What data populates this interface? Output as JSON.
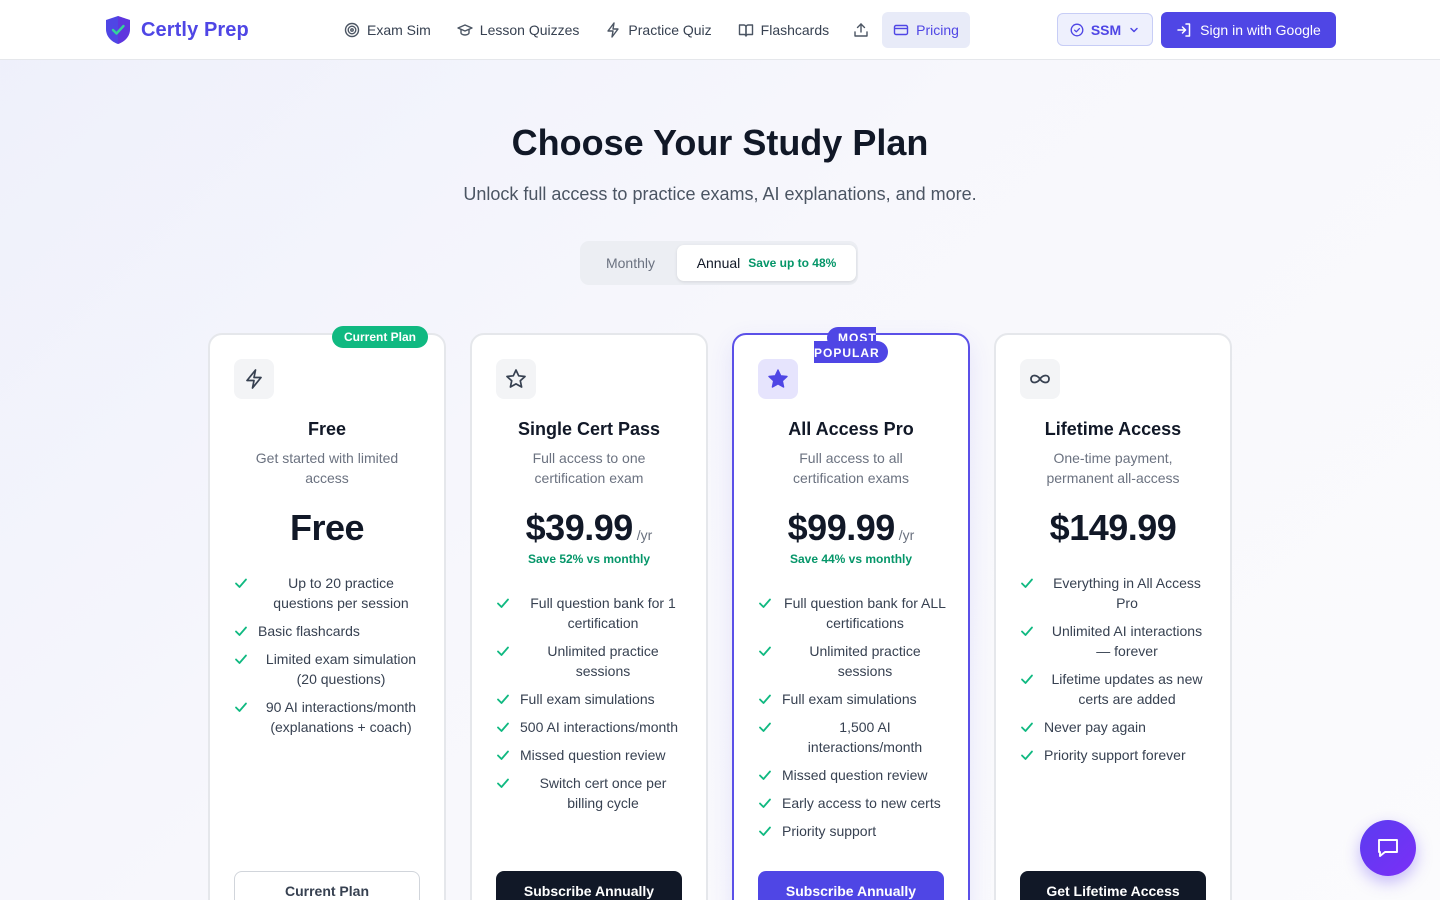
{
  "header": {
    "brand": "Certly Prep",
    "nav": [
      {
        "label": "Exam Sim",
        "icon": "target-icon"
      },
      {
        "label": "Lesson Quizzes",
        "icon": "graduation-cap-icon"
      },
      {
        "label": "Practice Quiz",
        "icon": "lightning-icon"
      },
      {
        "label": "Flashcards",
        "icon": "book-open-icon"
      },
      {
        "label": "",
        "icon": "upload-icon"
      },
      {
        "label": "Pricing",
        "icon": "credit-card-icon",
        "active": true
      }
    ],
    "cert_selector": "SSM",
    "sign_in": "Sign in with Google"
  },
  "hero": {
    "title": "Choose Your Study Plan",
    "subtitle": "Unlock full access to practice exams, AI explanations, and more."
  },
  "billing_toggle": {
    "monthly": "Monthly",
    "annual": "Annual",
    "annual_savings": "Save up to 48%",
    "selected": "annual"
  },
  "plans": [
    {
      "name": "Free",
      "description": "Get started with limited access",
      "price": "Free",
      "period": "",
      "savings": "",
      "badge": "Current Plan",
      "icon": "lightning-icon",
      "features": [
        "Up to 20 practice questions per session",
        "Basic flashcards",
        "Limited exam simulation (20 questions)",
        "90 AI interactions/month (explanations + coach)"
      ],
      "cta": "Current Plan"
    },
    {
      "name": "Single Cert Pass",
      "description": "Full access to one certification exam",
      "price": "$39.99",
      "period": "/yr",
      "savings": "Save 52% vs monthly",
      "badge": "",
      "icon": "star-outline-icon",
      "features": [
        "Full question bank for 1 certification",
        "Unlimited practice sessions",
        "Full exam simulations",
        "500 AI interactions/month",
        "Missed question review",
        "Switch cert once per billing cycle"
      ],
      "cta": "Subscribe Annually"
    },
    {
      "name": "All Access Pro",
      "description": "Full access to all certification exams",
      "price": "$99.99",
      "period": "/yr",
      "savings": "Save 44% vs monthly",
      "badge_line1": "MOST",
      "badge_line2": "POPULAR",
      "icon": "star-filled-icon",
      "features": [
        "Full question bank for ALL certifications",
        "Unlimited practice sessions",
        "Full exam simulations",
        "1,500 AI interactions/month",
        "Missed question review",
        "Early access to new certs",
        "Priority support"
      ],
      "cta": "Subscribe Annually"
    },
    {
      "name": "Lifetime Access",
      "description": "One-time payment, permanent all-access",
      "price": "$149.99",
      "period": "",
      "savings": "",
      "badge": "",
      "icon": "infinity-icon",
      "features": [
        "Everything in All Access Pro",
        "Unlimited AI interactions — forever",
        "Lifetime updates as new certs are added",
        "Never pay again",
        "Priority support forever"
      ],
      "cta": "Get Lifetime Access"
    }
  ],
  "colors": {
    "brand": "#4f46e5",
    "success": "#10b981",
    "savings_text": "#059669",
    "dark_cta": "#111827"
  }
}
